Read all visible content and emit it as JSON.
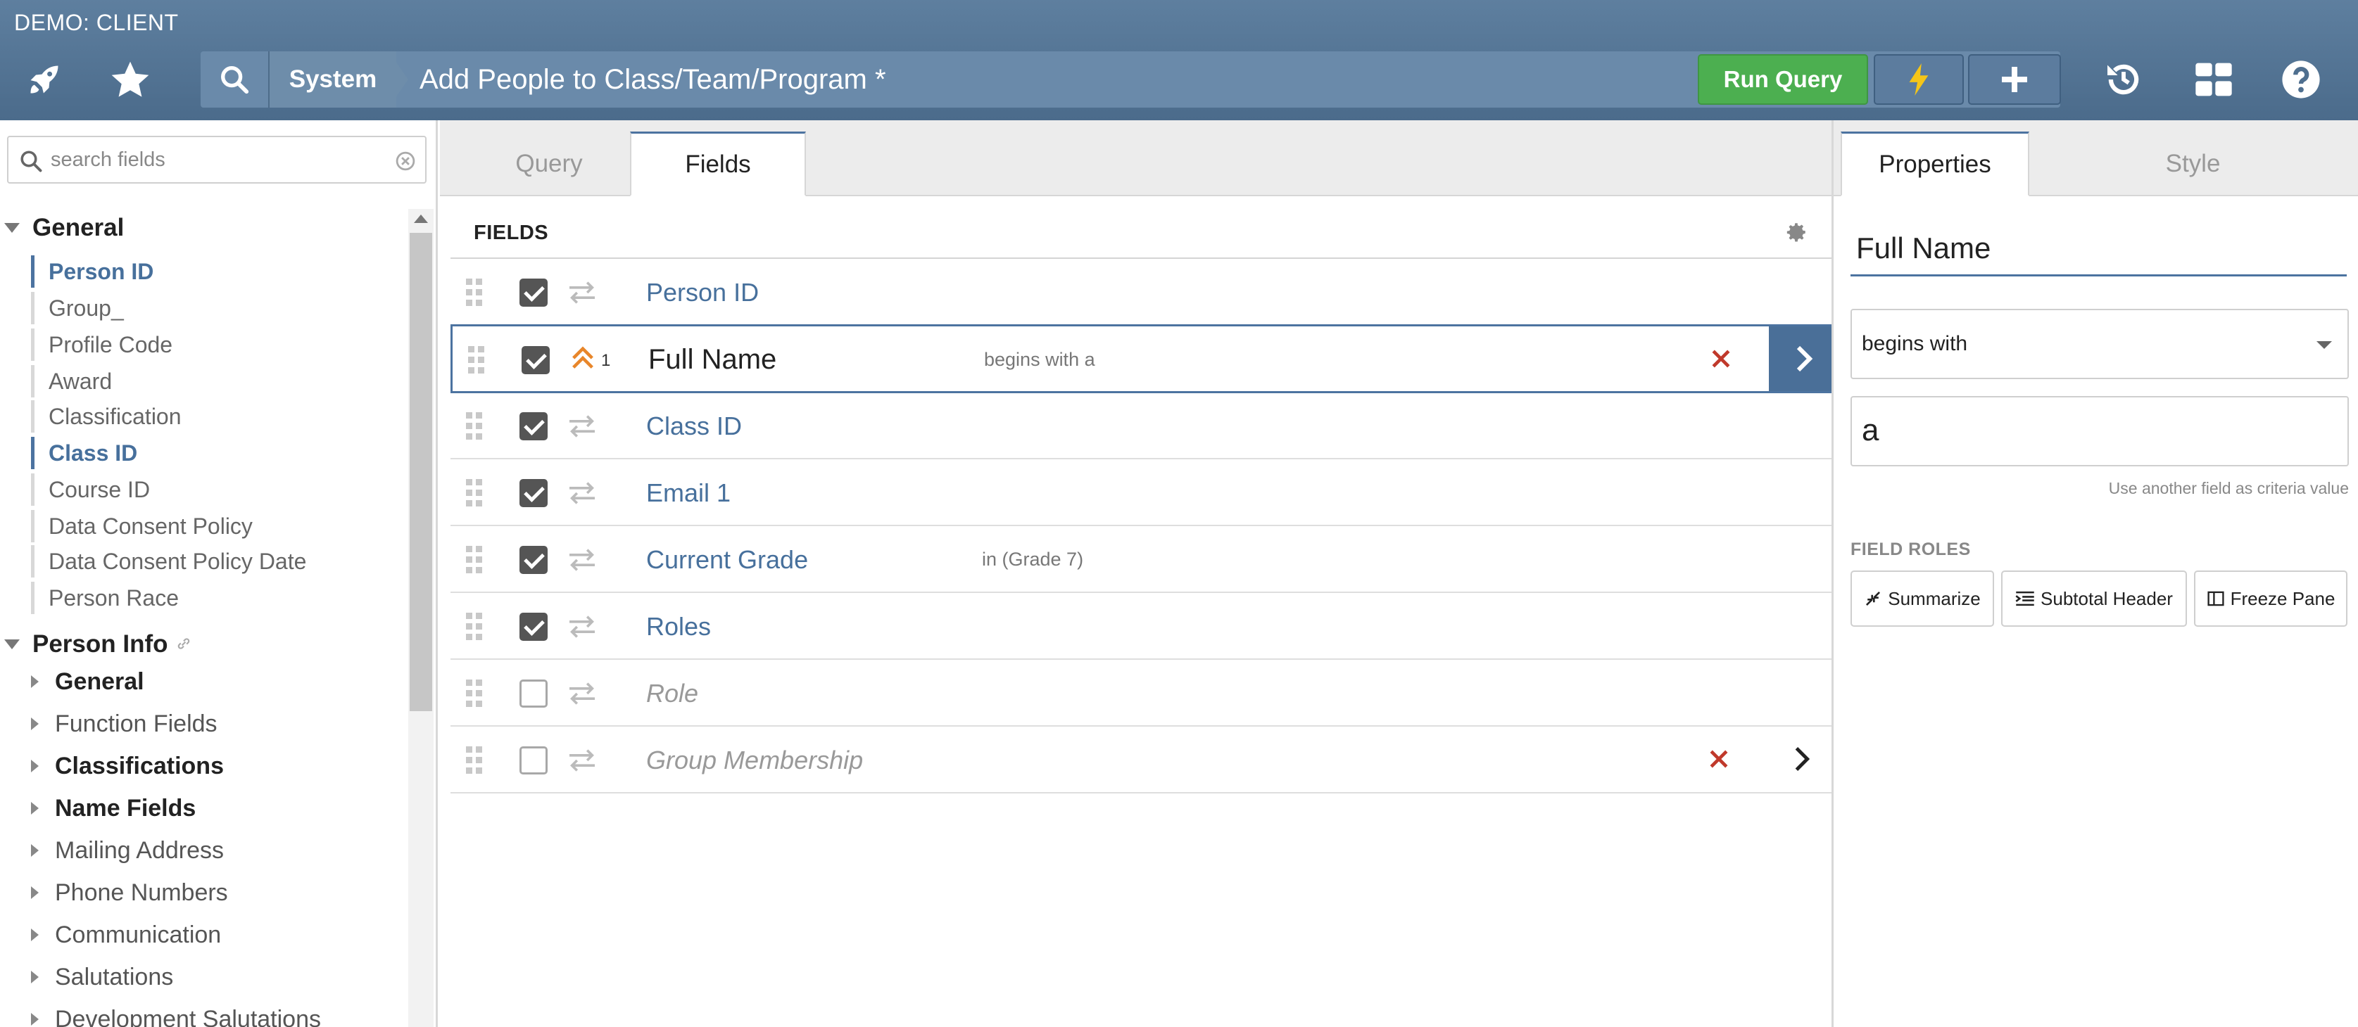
{
  "app": {
    "label": "DEMO: CLIENT"
  },
  "header": {
    "breadcrumb_root": "System",
    "title": "Add People to Class/Team/Program *",
    "run_query_label": "Run Query",
    "icons": [
      "rocket-icon",
      "star-icon",
      "search-icon",
      "bolt-icon",
      "plus-icon",
      "history-icon",
      "dashboard-grid-icon",
      "help-icon"
    ]
  },
  "sidebar": {
    "search_placeholder": "search fields",
    "general": {
      "label": "General",
      "items": [
        {
          "label": "Person ID",
          "active": true
        },
        {
          "label": "Group_",
          "active": false
        },
        {
          "label": "Profile Code",
          "active": false
        },
        {
          "label": "Award",
          "active": false
        },
        {
          "label": "Classification",
          "active": false
        },
        {
          "label": "Class ID",
          "active": true
        },
        {
          "label": "Course ID",
          "active": false
        },
        {
          "label": "Data Consent Policy",
          "active": false
        },
        {
          "label": "Data Consent Policy Date",
          "active": false
        },
        {
          "label": "Person Race",
          "active": false
        }
      ]
    },
    "person_info": {
      "label": "Person Info",
      "groups": [
        {
          "label": "General",
          "bold": true
        },
        {
          "label": "Function Fields",
          "bold": false
        },
        {
          "label": "Classifications",
          "bold": true
        },
        {
          "label": "Name Fields",
          "bold": true
        },
        {
          "label": "Mailing Address",
          "bold": false
        },
        {
          "label": "Phone Numbers",
          "bold": false
        },
        {
          "label": "Communication",
          "bold": false
        },
        {
          "label": "Salutations",
          "bold": false
        },
        {
          "label": "Development Salutations",
          "bold": false
        }
      ]
    }
  },
  "center": {
    "tabs": [
      "Query",
      "Fields"
    ],
    "active_tab": "Fields",
    "heading": "FIELDS",
    "rows": [
      {
        "name": "Person ID",
        "checked": true,
        "criteria": "",
        "selected": false
      },
      {
        "name": "Full Name",
        "checked": true,
        "criteria": "begins with a",
        "selected": true,
        "sort_order": "1"
      },
      {
        "name": "Class ID",
        "checked": true,
        "criteria": "",
        "selected": false
      },
      {
        "name": "Email 1",
        "checked": true,
        "criteria": "",
        "selected": false
      },
      {
        "name": "Current Grade",
        "checked": true,
        "criteria": "in (Grade 7)",
        "selected": false
      },
      {
        "name": "Roles",
        "checked": true,
        "criteria": "",
        "selected": false
      },
      {
        "name": "Role",
        "checked": false,
        "criteria": "",
        "selected": false
      },
      {
        "name": "Group Membership",
        "checked": false,
        "criteria": "",
        "selected": false
      }
    ]
  },
  "properties": {
    "tabs": [
      "Properties",
      "Style"
    ],
    "active_tab": "Properties",
    "field_name": "Full Name",
    "operator": "begins with",
    "value": "a",
    "another_field_link": "Use another field as criteria value",
    "roles_label": "FIELD ROLES",
    "roles": [
      "Summarize",
      "Subtotal Header",
      "Freeze Pane"
    ]
  },
  "colors": {
    "header_blue": "#5e7f9f",
    "accent_blue": "#4c73a0",
    "run_green": "#4caf50",
    "delete_red": "#c0392b",
    "sort_orange": "#e8862a"
  }
}
